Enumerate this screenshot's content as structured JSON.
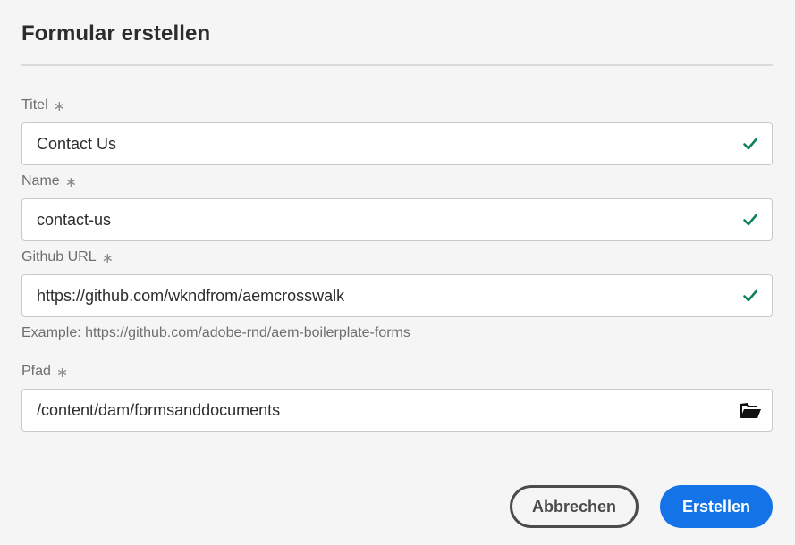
{
  "dialog": {
    "title": "Formular erstellen"
  },
  "fields": {
    "title": {
      "label": "Titel",
      "required_mark": "∗",
      "value": "Contact Us"
    },
    "name": {
      "label": "Name",
      "required_mark": "∗",
      "value": "contact-us"
    },
    "github_url": {
      "label": "Github URL",
      "required_mark": "∗",
      "value": "https://github.com/wkndfrom/aemcrosswalk",
      "help": "Example: https://github.com/adobe-rnd/aem-boilerplate-forms"
    },
    "path": {
      "label": "Pfad",
      "required_mark": "∗",
      "value": "/content/dam/formsanddocuments"
    }
  },
  "icons": {
    "valid": "checkmark-icon",
    "browse": "folder-open-icon"
  },
  "colors": {
    "valid_check": "#12805c",
    "primary_button": "#1473e6",
    "secondary_button_border": "#4b4b4b"
  },
  "buttons": {
    "cancel": "Abbrechen",
    "create": "Erstellen"
  }
}
